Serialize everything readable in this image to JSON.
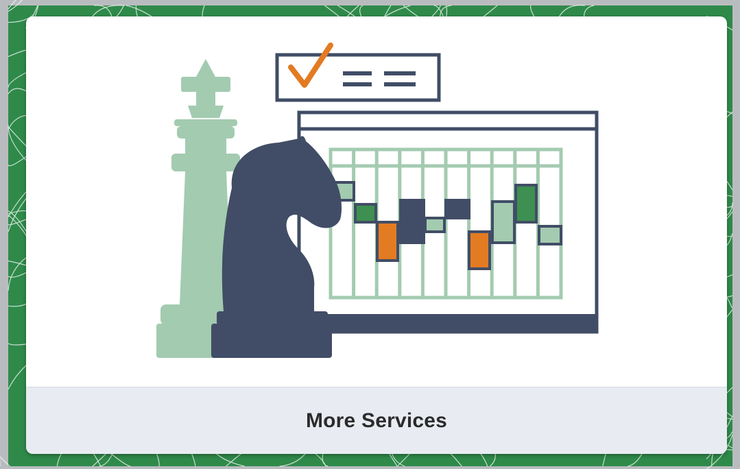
{
  "tile": {
    "title": "More Services"
  },
  "illustration": {
    "icons": [
      "chess-king-icon",
      "chess-knight-icon",
      "checklist-icon",
      "candlestick-chart-icon"
    ]
  },
  "colors": {
    "background_green": "#2f8a4a",
    "navy": "#414d66",
    "light_green": "#a3cbb0",
    "mid_green": "#3d9051",
    "orange": "#e37b22",
    "caption_bar": "#e8ecf2"
  }
}
